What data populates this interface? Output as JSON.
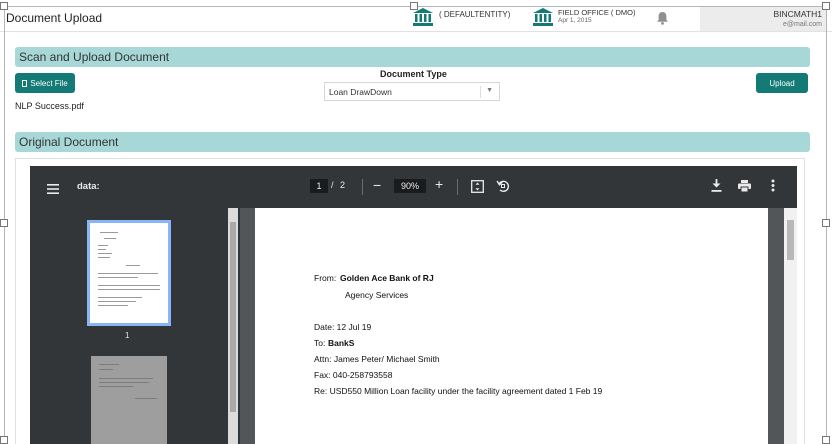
{
  "window": {
    "title": "Document Upload"
  },
  "header": {
    "entity_label": "( DEFAULTENTITY)",
    "office_name": "FIELD OFFICE  ( DMO)",
    "office_date": "Apr 1, 2015",
    "user_name": "BINCMATH1",
    "user_email": "e@mail.com"
  },
  "scan_section": {
    "title": "Scan and Upload Document",
    "select_file_label": "Select File",
    "select_file_icon": "file-icon",
    "file_name": "NLP Success.pdf",
    "document_type_label": "Document Type",
    "document_type_value": "Loan DrawDown",
    "upload_label": "Upload"
  },
  "original_section": {
    "title": "Original Document"
  },
  "pdf_viewer": {
    "doc_title": "data:",
    "current_page": "1",
    "page_separator": "/",
    "total_pages": "2",
    "zoom": "90%",
    "thumbnail_1_label": "1",
    "page_lines": {
      "from_label": "From:",
      "from_bank": "Golden Ace Bank of RJ",
      "agency": "Agency Services",
      "date": "Date: 12 Jul 19",
      "to_label": "To:",
      "to_value": "BankS",
      "attn": "Attn: James Peter/ Michael Smith",
      "fax": "Fax: 040-258793558",
      "re": "Re: USD550 Million Loan facility under the facility agreement dated 1 Feb 19"
    }
  },
  "colors": {
    "accent": "#137a75",
    "section_band": "#a7d8d7",
    "viewer_toolbar": "#323639",
    "viewer_bg": "#525659",
    "thumbnail_highlight": "#8ab4f8"
  }
}
